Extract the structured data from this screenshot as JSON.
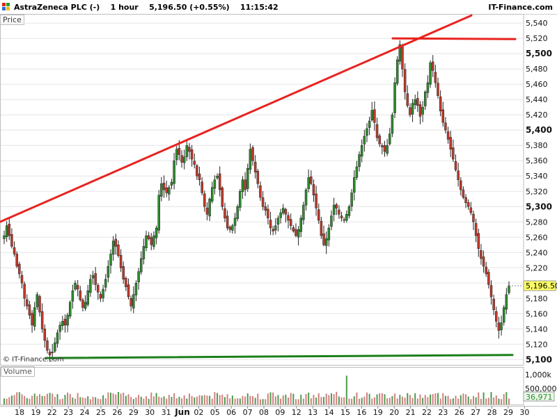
{
  "header": {
    "instrument": "AstraZeneca PLC (-)",
    "timeframe": "1 hour",
    "price": "5,196.50",
    "change": "(+0.55%)",
    "time": "11:15:42",
    "site": "IT-Finance.com"
  },
  "price_panel": {
    "label": "Price",
    "watermark": "© IT-Finance.com"
  },
  "volume_panel": {
    "label": "Volume"
  },
  "colors": {
    "up": "#2e8b2e",
    "down": "#c0392b",
    "resistance": "#e8231f",
    "support": "#1a7f1a",
    "grid": "#e6e6e6"
  },
  "chart_data": {
    "type": "candlestick",
    "title": "AstraZeneca PLC (-)",
    "interval": "1 hour",
    "last_price": 5196.5,
    "last_price_label": "5,196.50",
    "y_axis": {
      "range": [
        5093,
        5552
      ],
      "ticks": [
        5100,
        5120,
        5140,
        5160,
        5180,
        5200,
        5220,
        5240,
        5260,
        5280,
        5300,
        5320,
        5340,
        5360,
        5380,
        5400,
        5420,
        5440,
        5460,
        5480,
        5500,
        5520,
        5540
      ],
      "tick_labels": [
        "5,100",
        "5,120",
        "5,140",
        "5,160",
        "5,180",
        "5,200",
        "5,220",
        "5,240",
        "5,260",
        "5,280",
        "5,300",
        "5,320",
        "5,340",
        "5,360",
        "5,380",
        "5,400",
        "5,420",
        "5,440",
        "5,460",
        "5,480",
        "5,500",
        "5,520",
        "5,540"
      ],
      "bold_ticks": [
        "5,100",
        "5,300",
        "5,400",
        "5,500"
      ]
    },
    "x_axis": {
      "labels": [
        "18",
        "19",
        "22",
        "23",
        "24",
        "25",
        "26",
        "29",
        "30",
        "31",
        "Jun",
        "02",
        "05",
        "06",
        "07",
        "08",
        "09",
        "12",
        "13",
        "14",
        "15",
        "16",
        "19",
        "20",
        "21",
        "22",
        "23",
        "26",
        "27",
        "28",
        "29",
        "30"
      ]
    },
    "volume_axis": {
      "tick_labels": [
        "1,000k",
        "500,000"
      ],
      "last_volume": "36,971",
      "max": 1300000
    },
    "trend_lines": [
      {
        "name": "resistance",
        "points": [
          [
            "May 17",
            5280
          ],
          [
            "Jun 27",
            5550
          ]
        ],
        "color": "#e8231f"
      },
      {
        "name": "top",
        "points": [
          [
            "Jun 22",
            5520
          ],
          [
            "Jun 30",
            5519
          ]
        ],
        "color": "#e8231f"
      },
      {
        "name": "support",
        "points": [
          [
            "May 22",
            5102
          ],
          [
            "Jun 30",
            5106
          ]
        ],
        "color": "#1a7f1a"
      }
    ],
    "close_path": [
      5262,
      5275,
      5262,
      5248,
      5238,
      5222,
      5212,
      5200,
      5180,
      5170,
      5158,
      5145,
      5168,
      5185,
      5162,
      5140,
      5125,
      5112,
      5106,
      5110,
      5122,
      5135,
      5145,
      5150,
      5145,
      5158,
      5175,
      5190,
      5200,
      5192,
      5178,
      5168,
      5175,
      5190,
      5205,
      5210,
      5198,
      5188,
      5180,
      5192,
      5205,
      5222,
      5238,
      5255,
      5248,
      5236,
      5220,
      5205,
      5195,
      5182,
      5170,
      5185,
      5200,
      5215,
      5232,
      5248,
      5262,
      5258,
      5250,
      5262,
      5272,
      5315,
      5330,
      5322,
      5318,
      5325,
      5332,
      5360,
      5375,
      5368,
      5358,
      5365,
      5380,
      5372,
      5362,
      5355,
      5340,
      5335,
      5318,
      5300,
      5290,
      5310,
      5325,
      5335,
      5340,
      5322,
      5300,
      5285,
      5272,
      5270,
      5275,
      5285,
      5300,
      5320,
      5335,
      5322,
      5350,
      5375,
      5360,
      5345,
      5330,
      5312,
      5300,
      5295,
      5285,
      5272,
      5268,
      5275,
      5285,
      5292,
      5298,
      5290,
      5282,
      5275,
      5268,
      5262,
      5270,
      5285,
      5302,
      5322,
      5338,
      5330,
      5315,
      5298,
      5282,
      5262,
      5250,
      5258,
      5272,
      5288,
      5302,
      5298,
      5290,
      5285,
      5282,
      5290,
      5300,
      5318,
      5338,
      5352,
      5368,
      5380,
      5392,
      5402,
      5412,
      5426,
      5410,
      5390,
      5382,
      5378,
      5372,
      5380,
      5395,
      5420,
      5462,
      5492,
      5512,
      5480,
      5450,
      5432,
      5420,
      5435,
      5440,
      5432,
      5418,
      5430,
      5450,
      5462,
      5488,
      5478,
      5462,
      5445,
      5425,
      5410,
      5400,
      5388,
      5375,
      5362,
      5348,
      5335,
      5322,
      5312,
      5305,
      5300,
      5292,
      5280,
      5262,
      5245,
      5232,
      5222,
      5212,
      5198,
      5182,
      5165,
      5150,
      5138,
      5148,
      5168,
      5185,
      5196.5
    ],
    "volume_spike": {
      "label": "Jun 16",
      "value": 1000000
    }
  }
}
